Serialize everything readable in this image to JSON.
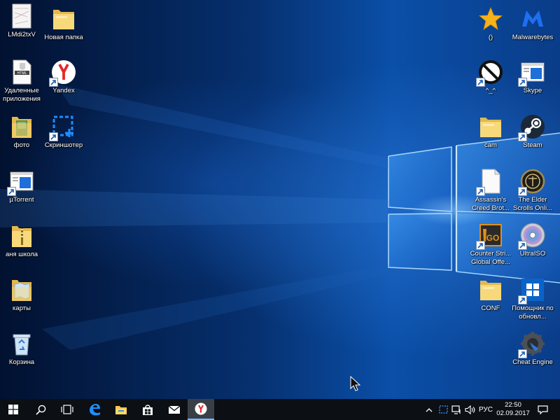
{
  "desktop": {
    "icons_left": [
      {
        "label": "LMdi2txV",
        "icon": "image-file-icon"
      },
      {
        "label": "Новая папка",
        "icon": "folder-icon"
      },
      {
        "label": "Удаленные приложения",
        "icon": "html-file-icon"
      },
      {
        "label": "Yandex",
        "icon": "yandex-browser-icon"
      },
      {
        "label": "фото",
        "icon": "photo-folder-icon"
      },
      {
        "label": "Скриншотер",
        "icon": "screenshot-tool-icon"
      },
      {
        "label": "µTorrent",
        "icon": "window-app-icon"
      },
      {
        "label": "аня школа",
        "icon": "zip-folder-icon"
      },
      {
        "label": "карты",
        "icon": "maps-folder-icon"
      },
      {
        "label": "Корзина",
        "icon": "recycle-bin-icon"
      }
    ],
    "icons_right": [
      {
        "label": "()",
        "icon": "star-icon"
      },
      {
        "label": "Malwarebytes",
        "icon": "malwarebytes-icon"
      },
      {
        "label": "^_^",
        "icon": "prohibited-icon"
      },
      {
        "label": "Skype",
        "icon": "window-app-icon"
      },
      {
        "label": "cam",
        "icon": "folder-icon"
      },
      {
        "label": "Steam",
        "icon": "steam-icon"
      },
      {
        "label": "Assassin's Creed Brot...",
        "icon": "blank-file-icon"
      },
      {
        "label": "The Elder Scrolls Onli...",
        "icon": "elder-scrolls-icon"
      },
      {
        "label": "Counter Stri... Global Offe...",
        "icon": "csgo-icon"
      },
      {
        "label": "UltraISO",
        "icon": "disc-icon"
      },
      {
        "label": "CONF",
        "icon": "folder-icon"
      },
      {
        "label": "Помощник по обновл...",
        "icon": "windows-update-icon"
      },
      {
        "label": "Cheat Engine",
        "icon": "cheat-engine-icon"
      }
    ]
  },
  "taskbar": {
    "start": "windows-logo-icon",
    "search": "search-icon",
    "task_view": "task-view-icon",
    "pinned": [
      "edge-icon",
      "file-explorer-icon",
      "store-icon",
      "mail-icon",
      "yandex-browser-icon"
    ],
    "tray": {
      "language": "РУС",
      "time": "22:50",
      "date": "02.09.2017"
    }
  },
  "colors": {
    "taskbar": "#0c0f14",
    "accent": "#0a63c9",
    "wallpaper_light": "#5fb2ff"
  }
}
